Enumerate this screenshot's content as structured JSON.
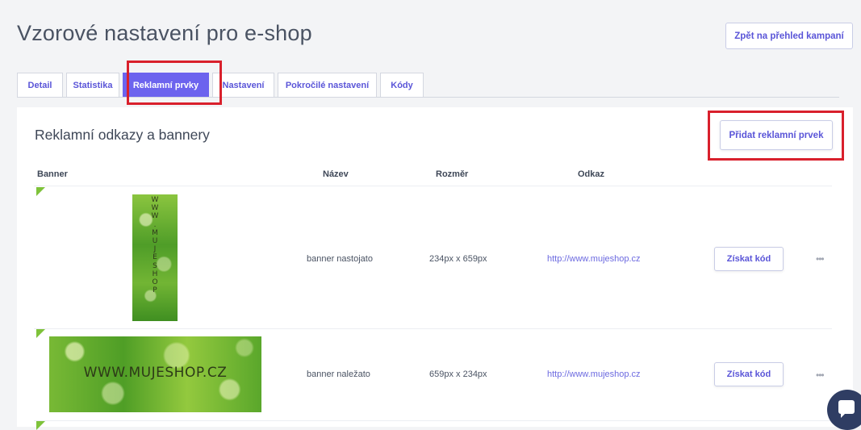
{
  "header": {
    "title": "Vzorové nastavení pro e-shop",
    "back_label": "Zpět na přehled kampaní"
  },
  "tabs": [
    {
      "label": "Detail",
      "active": false
    },
    {
      "label": "Statistika",
      "active": false
    },
    {
      "label": "Reklamní prvky",
      "active": true
    },
    {
      "label": "Nastavení",
      "active": false
    },
    {
      "label": "Pokročilé nastavení",
      "active": false
    },
    {
      "label": "Kódy",
      "active": false
    }
  ],
  "section": {
    "title": "Reklamní odkazy a bannery",
    "add_label": "Přidat reklamní prvek"
  },
  "table": {
    "columns": [
      "Banner",
      "Název",
      "Rozměr",
      "Odkaz"
    ],
    "rows": [
      {
        "banner_text": "W\nW\nW\n.\nM\nU\nJ\nE\nS\nH\nO\nP",
        "name": "banner nastojato",
        "size": "234px x 659px",
        "link": "http://www.mujeshop.cz",
        "action_label": "Získat kód",
        "more": "•••"
      },
      {
        "banner_text": "WWW.MUJESHOP.CZ",
        "name": "banner naležato",
        "size": "659px x 234px",
        "link": "http://www.mujeshop.cz",
        "action_label": "Získat kód",
        "more": "•••"
      }
    ]
  },
  "colors": {
    "accent": "#6c63ee",
    "highlight": "#d9202c",
    "banner_green": "#7ec23a"
  },
  "chat_icon": "chat-bubble-icon"
}
